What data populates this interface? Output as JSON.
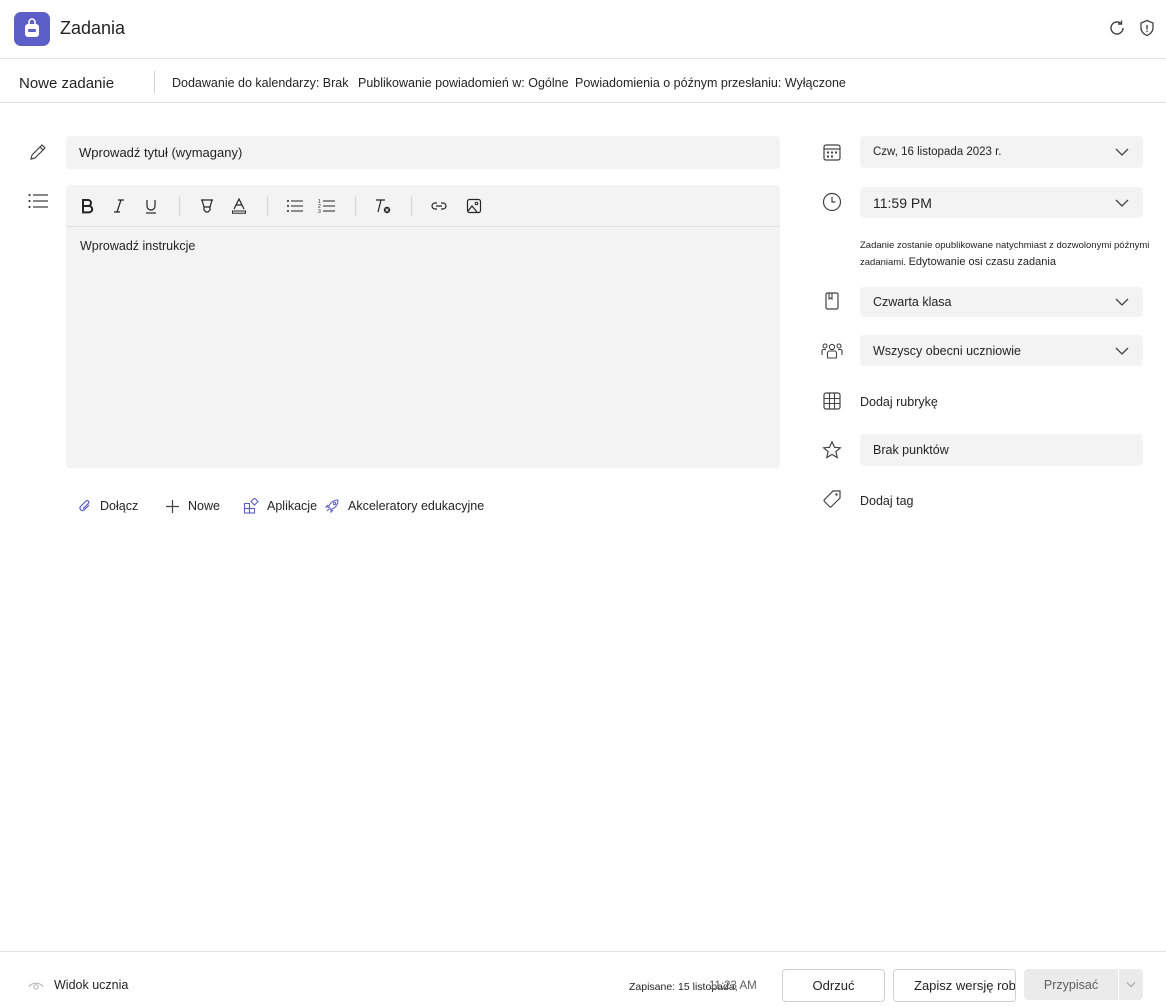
{
  "app": {
    "title": "Zadania",
    "icons": [
      "backpack-icon",
      "refresh-icon",
      "shield-icon"
    ]
  },
  "meta": {
    "title": "Nowe zadanie",
    "calendar": "Dodawanie do kalendarzy: Brak",
    "notifications": "Publikowanie powiadomień w: Ogólne",
    "late": "Powiadomienia o późnym przesłaniu: Wyłączone"
  },
  "form": {
    "title_placeholder": "Wprowadź tytuł (wymagany)",
    "instructions_placeholder": "Wprowadź instrukcje",
    "toolbar": [
      "bold-icon",
      "italic-icon",
      "underline-icon",
      "highlight-icon",
      "font-color-icon",
      "bulleted-list-icon",
      "numbered-list-icon",
      "clear-formatting-icon",
      "link-icon",
      "image-icon"
    ],
    "attach": {
      "attach": "Dołącz",
      "new": "Nowe",
      "apps": "Aplikacje",
      "accelerators": "Akceleratory edukacyjne"
    }
  },
  "settings": {
    "due_date": "Czw, 16 listopada 2023 r.",
    "due_time": "11:59 PM",
    "info_text": "Zadanie zostanie opublikowane natychmiast z dozwolonymi późnymi zadaniami.",
    "info_link": "Edytowanie osi czasu zadania",
    "class": "Czwarta klasa",
    "students": "Wszyscy obecni uczniowie",
    "rubric": "Dodaj rubrykę",
    "points": "Brak punktów",
    "tag": "Dodaj tag"
  },
  "footer": {
    "student_view": "Widok ucznia",
    "saved": "Zapisane: 15 listopada,",
    "saved_time": "11:23 AM",
    "discard": "Odrzuć",
    "save_draft": "Zapisz wersję roboczą",
    "assign": "Przypisać"
  },
  "colors": {
    "brand": "#5b5fc7",
    "field": "#f3f3f3",
    "border": "#e1e1e1"
  }
}
